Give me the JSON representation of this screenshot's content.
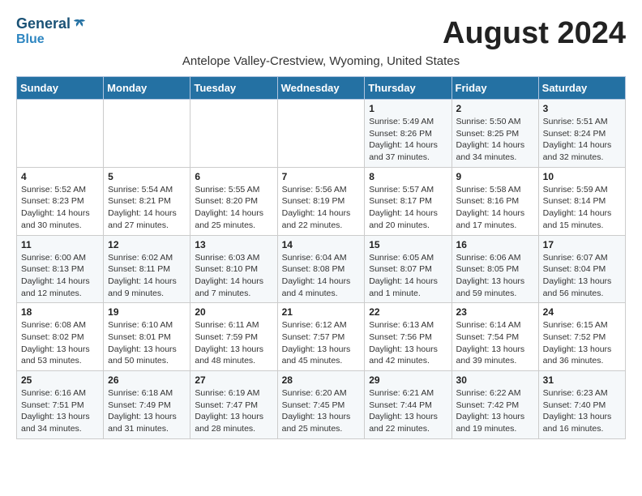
{
  "logo": {
    "line1": "General",
    "line2": "Blue"
  },
  "title": "August 2024",
  "subtitle": "Antelope Valley-Crestview, Wyoming, United States",
  "headers": [
    "Sunday",
    "Monday",
    "Tuesday",
    "Wednesday",
    "Thursday",
    "Friday",
    "Saturday"
  ],
  "weeks": [
    [
      {
        "day": "",
        "info": ""
      },
      {
        "day": "",
        "info": ""
      },
      {
        "day": "",
        "info": ""
      },
      {
        "day": "",
        "info": ""
      },
      {
        "day": "1",
        "info": "Sunrise: 5:49 AM\nSunset: 8:26 PM\nDaylight: 14 hours\nand 37 minutes."
      },
      {
        "day": "2",
        "info": "Sunrise: 5:50 AM\nSunset: 8:25 PM\nDaylight: 14 hours\nand 34 minutes."
      },
      {
        "day": "3",
        "info": "Sunrise: 5:51 AM\nSunset: 8:24 PM\nDaylight: 14 hours\nand 32 minutes."
      }
    ],
    [
      {
        "day": "4",
        "info": "Sunrise: 5:52 AM\nSunset: 8:23 PM\nDaylight: 14 hours\nand 30 minutes."
      },
      {
        "day": "5",
        "info": "Sunrise: 5:54 AM\nSunset: 8:21 PM\nDaylight: 14 hours\nand 27 minutes."
      },
      {
        "day": "6",
        "info": "Sunrise: 5:55 AM\nSunset: 8:20 PM\nDaylight: 14 hours\nand 25 minutes."
      },
      {
        "day": "7",
        "info": "Sunrise: 5:56 AM\nSunset: 8:19 PM\nDaylight: 14 hours\nand 22 minutes."
      },
      {
        "day": "8",
        "info": "Sunrise: 5:57 AM\nSunset: 8:17 PM\nDaylight: 14 hours\nand 20 minutes."
      },
      {
        "day": "9",
        "info": "Sunrise: 5:58 AM\nSunset: 8:16 PM\nDaylight: 14 hours\nand 17 minutes."
      },
      {
        "day": "10",
        "info": "Sunrise: 5:59 AM\nSunset: 8:14 PM\nDaylight: 14 hours\nand 15 minutes."
      }
    ],
    [
      {
        "day": "11",
        "info": "Sunrise: 6:00 AM\nSunset: 8:13 PM\nDaylight: 14 hours\nand 12 minutes."
      },
      {
        "day": "12",
        "info": "Sunrise: 6:02 AM\nSunset: 8:11 PM\nDaylight: 14 hours\nand 9 minutes."
      },
      {
        "day": "13",
        "info": "Sunrise: 6:03 AM\nSunset: 8:10 PM\nDaylight: 14 hours\nand 7 minutes."
      },
      {
        "day": "14",
        "info": "Sunrise: 6:04 AM\nSunset: 8:08 PM\nDaylight: 14 hours\nand 4 minutes."
      },
      {
        "day": "15",
        "info": "Sunrise: 6:05 AM\nSunset: 8:07 PM\nDaylight: 14 hours\nand 1 minute."
      },
      {
        "day": "16",
        "info": "Sunrise: 6:06 AM\nSunset: 8:05 PM\nDaylight: 13 hours\nand 59 minutes."
      },
      {
        "day": "17",
        "info": "Sunrise: 6:07 AM\nSunset: 8:04 PM\nDaylight: 13 hours\nand 56 minutes."
      }
    ],
    [
      {
        "day": "18",
        "info": "Sunrise: 6:08 AM\nSunset: 8:02 PM\nDaylight: 13 hours\nand 53 minutes."
      },
      {
        "day": "19",
        "info": "Sunrise: 6:10 AM\nSunset: 8:01 PM\nDaylight: 13 hours\nand 50 minutes."
      },
      {
        "day": "20",
        "info": "Sunrise: 6:11 AM\nSunset: 7:59 PM\nDaylight: 13 hours\nand 48 minutes."
      },
      {
        "day": "21",
        "info": "Sunrise: 6:12 AM\nSunset: 7:57 PM\nDaylight: 13 hours\nand 45 minutes."
      },
      {
        "day": "22",
        "info": "Sunrise: 6:13 AM\nSunset: 7:56 PM\nDaylight: 13 hours\nand 42 minutes."
      },
      {
        "day": "23",
        "info": "Sunrise: 6:14 AM\nSunset: 7:54 PM\nDaylight: 13 hours\nand 39 minutes."
      },
      {
        "day": "24",
        "info": "Sunrise: 6:15 AM\nSunset: 7:52 PM\nDaylight: 13 hours\nand 36 minutes."
      }
    ],
    [
      {
        "day": "25",
        "info": "Sunrise: 6:16 AM\nSunset: 7:51 PM\nDaylight: 13 hours\nand 34 minutes."
      },
      {
        "day": "26",
        "info": "Sunrise: 6:18 AM\nSunset: 7:49 PM\nDaylight: 13 hours\nand 31 minutes."
      },
      {
        "day": "27",
        "info": "Sunrise: 6:19 AM\nSunset: 7:47 PM\nDaylight: 13 hours\nand 28 minutes."
      },
      {
        "day": "28",
        "info": "Sunrise: 6:20 AM\nSunset: 7:45 PM\nDaylight: 13 hours\nand 25 minutes."
      },
      {
        "day": "29",
        "info": "Sunrise: 6:21 AM\nSunset: 7:44 PM\nDaylight: 13 hours\nand 22 minutes."
      },
      {
        "day": "30",
        "info": "Sunrise: 6:22 AM\nSunset: 7:42 PM\nDaylight: 13 hours\nand 19 minutes."
      },
      {
        "day": "31",
        "info": "Sunrise: 6:23 AM\nSunset: 7:40 PM\nDaylight: 13 hours\nand 16 minutes."
      }
    ]
  ]
}
